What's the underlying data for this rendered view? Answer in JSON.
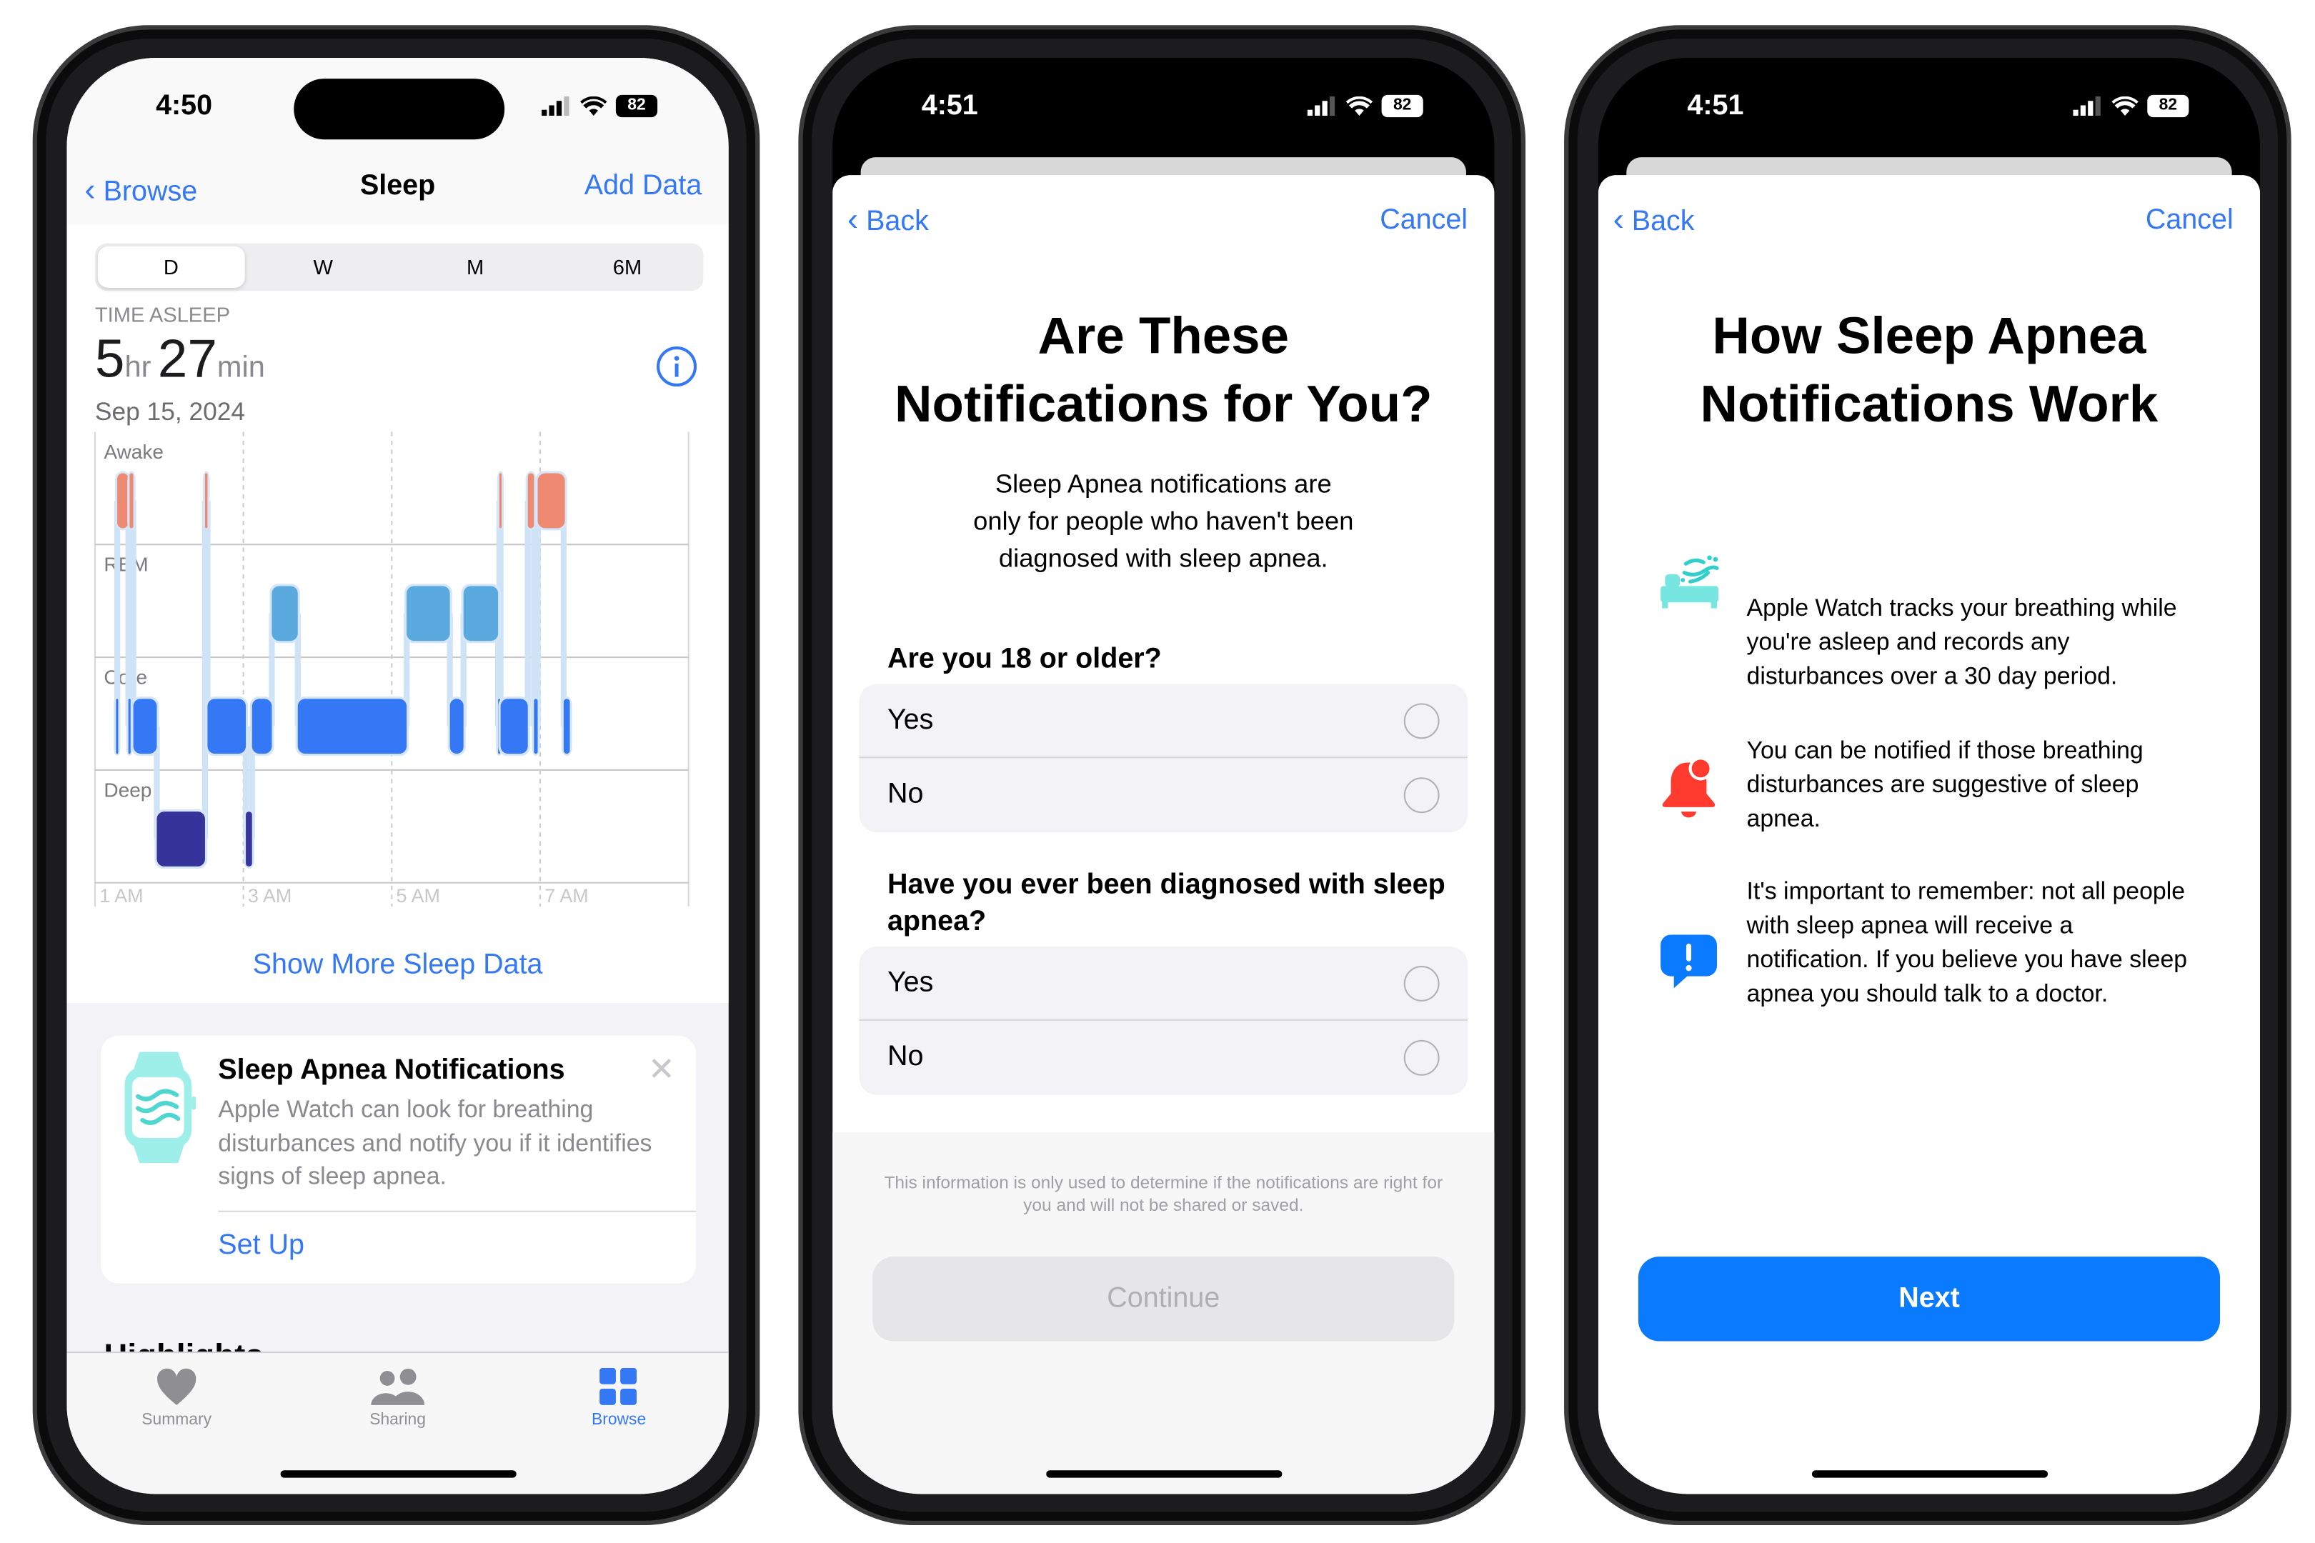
{
  "phone1": {
    "status": {
      "time": "4:50",
      "battery": "82"
    },
    "nav": {
      "back_label": "Browse",
      "title": "Sleep",
      "action_label": "Add Data"
    },
    "segments": [
      {
        "label": "D",
        "selected": true
      },
      {
        "label": "W"
      },
      {
        "label": "M"
      },
      {
        "label": "6M"
      }
    ],
    "summary": {
      "label": "TIME ASLEEP",
      "hours": "5",
      "hours_unit": "hr",
      "minutes": "27",
      "minutes_unit": "min",
      "date": "Sep 15, 2024"
    },
    "show_more_label": "Show More Sleep Data",
    "card": {
      "title": "Sleep Apnea Notifications",
      "body": "Apple Watch can look for breathing disturbances and notify you if it identifies signs of sleep apnea.",
      "action_label": "Set Up"
    },
    "highlights_label": "Highlights",
    "tabs": [
      {
        "label": "Summary",
        "icon": "heart-icon"
      },
      {
        "label": "Sharing",
        "icon": "people-icon"
      },
      {
        "label": "Browse",
        "icon": "grid-icon",
        "selected": true
      }
    ]
  },
  "chart_data": {
    "type": "timeline",
    "stages": [
      "Awake",
      "REM",
      "Core",
      "Deep"
    ],
    "x_ticks": [
      "1 AM",
      "3 AM",
      "5 AM",
      "7 AM"
    ],
    "colors": {
      "Awake": "#ee8a72",
      "REM": "#5aaae0",
      "Core": "#3478f6",
      "Deep": "#36339b"
    },
    "segments": [
      {
        "stage": "Core",
        "start": "1:17",
        "end": "1:18"
      },
      {
        "stage": "Awake",
        "start": "1:18",
        "end": "1:27"
      },
      {
        "stage": "Core",
        "start": "1:27",
        "end": "1:28"
      },
      {
        "stage": "Awake",
        "start": "1:28",
        "end": "1:31"
      },
      {
        "stage": "Core",
        "start": "1:31",
        "end": "1:50"
      },
      {
        "stage": "Deep",
        "start": "1:50",
        "end": "2:29"
      },
      {
        "stage": "Awake",
        "start": "2:29",
        "end": "2:31"
      },
      {
        "stage": "Core",
        "start": "2:31",
        "end": "3:02"
      },
      {
        "stage": "Deep",
        "start": "3:02",
        "end": "3:07"
      },
      {
        "stage": "Core",
        "start": "3:07",
        "end": "3:23"
      },
      {
        "stage": "REM",
        "start": "3:23",
        "end": "3:44"
      },
      {
        "stage": "Core",
        "start": "3:44",
        "end": "5:12"
      },
      {
        "stage": "REM",
        "start": "5:12",
        "end": "5:47"
      },
      {
        "stage": "Core",
        "start": "5:47",
        "end": "5:58"
      },
      {
        "stage": "REM",
        "start": "5:58",
        "end": "6:26"
      },
      {
        "stage": "Core",
        "start": "6:26",
        "end": "6:27"
      },
      {
        "stage": "Awake",
        "start": "6:27",
        "end": "6:28"
      },
      {
        "stage": "Core",
        "start": "6:28",
        "end": "6:50"
      },
      {
        "stage": "Awake",
        "start": "6:50",
        "end": "6:55"
      },
      {
        "stage": "Core",
        "start": "6:55",
        "end": "6:58"
      },
      {
        "stage": "Awake",
        "start": "6:58",
        "end": "7:20"
      },
      {
        "stage": "Core",
        "start": "7:19",
        "end": "7:24"
      }
    ],
    "x_range": [
      "1:00",
      "9:00"
    ]
  },
  "phone2": {
    "status": {
      "time": "4:51",
      "battery": "82"
    },
    "nav": {
      "back_label": "Back",
      "cancel_label": "Cancel"
    },
    "title_lines": [
      "Are These",
      "Notifications for You?"
    ],
    "intro_lines": [
      "Sleep Apnea notifications are",
      "only for people who haven't been",
      "diagnosed with sleep apnea."
    ],
    "questions": [
      {
        "text": "Are you 18 or older?",
        "options": [
          "Yes",
          "No"
        ]
      },
      {
        "text": "Have you ever been diagnosed with sleep apnea?",
        "options": [
          "Yes",
          "No"
        ]
      }
    ],
    "footnote": "This information is only used to determine if the notifications are right for you and will not be shared or saved.",
    "continue_label": "Continue"
  },
  "phone3": {
    "status": {
      "time": "4:51",
      "battery": "82"
    },
    "nav": {
      "back_label": "Back",
      "cancel_label": "Cancel"
    },
    "title_lines": [
      "How Sleep Apnea",
      "Notifications Work"
    ],
    "items": [
      {
        "icon": "bed-breathing-icon",
        "text": "Apple Watch tracks your breathing while you're asleep and records any disturbances over a 30 day period."
      },
      {
        "icon": "bell-badge-icon",
        "text": "You can be notified if those breathing disturbances are suggestive of sleep apnea."
      },
      {
        "icon": "exclamation-bubble-icon",
        "text": "It's important to remember: not all people with sleep apnea will receive a notification. If you believe you have sleep apnea you should talk to a doctor."
      }
    ],
    "next_label": "Next"
  }
}
